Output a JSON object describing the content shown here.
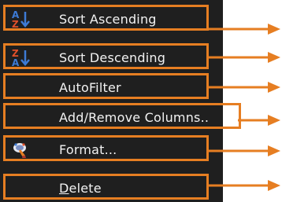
{
  "menu": {
    "items": [
      {
        "label": "Sort Ascending",
        "icon": "sort-ascending-icon"
      },
      {
        "label": "Sort Descending",
        "icon": "sort-descending-icon"
      },
      {
        "label": "AutoFilter",
        "icon": ""
      },
      {
        "label": "Add/Remove Columns..",
        "icon": ""
      },
      {
        "label": "Format...",
        "icon": "format-brush-icon"
      },
      {
        "label_accel": "D",
        "label_rest": "elete",
        "icon": ""
      }
    ]
  },
  "colors": {
    "highlight": "#e67e22",
    "menu_background": "#1f1f1f",
    "text": "#f2f2f2",
    "sort_letter_a": "#3d7bd6",
    "sort_letter_z": "#e0502a"
  },
  "icons": {
    "sort_a": "A",
    "sort_z": "Z"
  }
}
